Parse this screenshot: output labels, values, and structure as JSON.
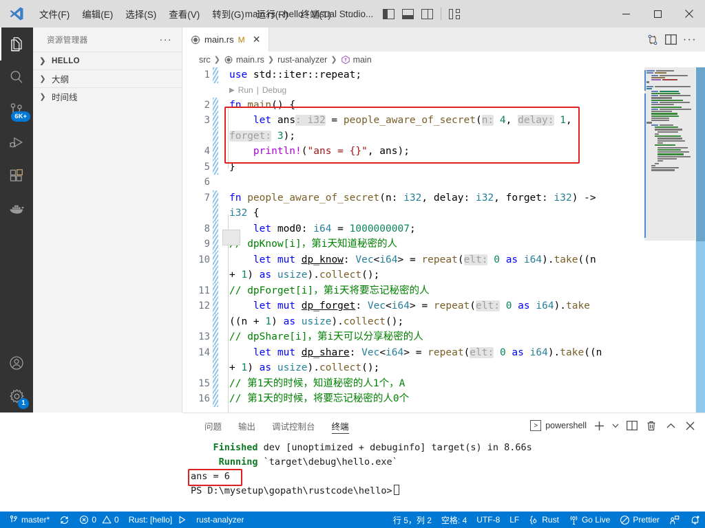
{
  "titlebar": {
    "menus": [
      "文件(F)",
      "编辑(E)",
      "选择(S)",
      "查看(V)",
      "转到(G)",
      "运行(R)",
      "终端(T)"
    ],
    "overflow": "···",
    "window_title": "main.rs - hello - Visual Studio...",
    "layout_icons": [
      "toggle-primary-sidebar-icon",
      "toggle-panel-icon",
      "toggle-secondary-sidebar-icon",
      "customize-layout-icon"
    ],
    "minimize": "─",
    "maximize": "□",
    "close": "✕"
  },
  "activitybar": {
    "items": [
      {
        "name": "explorer",
        "badge": ""
      },
      {
        "name": "search",
        "badge": ""
      },
      {
        "name": "source-control",
        "badge": "6K+"
      },
      {
        "name": "run-and-debug",
        "badge": ""
      },
      {
        "name": "extensions",
        "badge": ""
      },
      {
        "name": "docker",
        "badge": ""
      }
    ],
    "bottom": [
      {
        "name": "accounts",
        "badge": ""
      },
      {
        "name": "settings",
        "badge": "1"
      }
    ]
  },
  "sidebar": {
    "title": "资源管理器",
    "more": "···",
    "sections": [
      {
        "label": "HELLO",
        "expanded": false,
        "bold": true
      },
      {
        "label": "大纲",
        "expanded": false,
        "bold": false
      },
      {
        "label": "时间线",
        "expanded": false,
        "bold": false
      }
    ]
  },
  "editor": {
    "tab": {
      "label": "main.rs",
      "dirty": "M",
      "close": "✕",
      "icon": "rust-file-icon"
    },
    "tab_actions": [
      "split-and-compare-icon",
      "split-editor-icon",
      "more-actions-icon"
    ],
    "breadcrumb": [
      "src",
      "main.rs",
      "rust-analyzer",
      "main"
    ],
    "codelens": {
      "run": "Run",
      "sep": "|",
      "debug": "Debug"
    },
    "highlight_box": "red-selection-rectangle"
  },
  "code": {
    "lines": [
      {
        "n": "1",
        "modified": true
      },
      {
        "n": "2",
        "modified": true
      },
      {
        "n": "3",
        "modified": true
      },
      {
        "n": "4",
        "modified": true
      },
      {
        "n": "5",
        "modified": true
      },
      {
        "n": "6",
        "modified": false
      },
      {
        "n": "7",
        "modified": true
      },
      {
        "n": "8",
        "modified": true
      },
      {
        "n": "9",
        "modified": true
      },
      {
        "n": "10",
        "modified": true
      },
      {
        "n": "11",
        "modified": true
      },
      {
        "n": "12",
        "modified": true
      },
      {
        "n": "13",
        "modified": true
      },
      {
        "n": "14",
        "modified": true
      },
      {
        "n": "15",
        "modified": true
      },
      {
        "n": "16",
        "modified": true
      }
    ],
    "text": {
      "l1": "use std::iter::repeat;",
      "l2": "fn main() {",
      "l3a": "let ans: i32 = people_aware_of_secret(n: 4, delay: 1,",
      "l3b": "forget: 3);",
      "l4": "println!(\"ans = {}\", ans);",
      "l5": "}",
      "l6": "",
      "l7a": "fn people_aware_of_secret(n: i32, delay: i32, forget: i32) ->",
      "l7b": "i32 {",
      "l8": "let mod0: i64 = 1000000007;",
      "l9": "// dpKnow[i]，第i天知道秘密的人",
      "l10a": "let mut dp_know: Vec<i64> = repeat(elt: 0 as i64).take((n",
      "l10b": "+ 1) as usize).collect();",
      "l11": "// dpForget[i]，第i天将要忘记秘密的人",
      "l12a": "let mut dp_forget: Vec<i64> = repeat(elt: 0 as i64).take",
      "l12b": "((n + 1) as usize).collect();",
      "l13": "// dpShare[i]，第i天可以分享秘密的人",
      "l14a": "let mut dp_share: Vec<i64> = repeat(elt: 0 as i64).take((n",
      "l14b": "+ 1) as usize).collect();",
      "l15": "// 第1天的时候，知道秘密的人1个，A",
      "l16": "// 第1天的时候，将要忘记秘密的人0个"
    }
  },
  "panel": {
    "tabs": [
      "问题",
      "输出",
      "调试控制台",
      "终端"
    ],
    "active_tab": "终端",
    "shell": "powershell",
    "actions": [
      "new-terminal-icon",
      "terminal-dropdown-icon",
      "split-terminal-icon",
      "kill-terminal-icon",
      "collapse-panel-icon",
      "close-panel-icon"
    ],
    "terminal": {
      "line1_label": "Finished",
      "line1_rest": " dev [unoptimized + debuginfo] target(s) in 8.66s",
      "line2_label": "Running",
      "line2_rest": " `target\\debug\\hello.exe`",
      "line3": "ans = 6",
      "line4": "PS D:\\mysetup\\gopath\\rustcode\\hello>"
    }
  },
  "statusbar": {
    "left": [
      {
        "name": "remote-branch",
        "label": "master*",
        "icon": "source-control-icon"
      },
      {
        "name": "sync",
        "label": "",
        "icon": "sync-icon"
      },
      {
        "name": "problems",
        "label": "0  0",
        "errors": "0",
        "warnings": "0",
        "icon": "error-warning-icon"
      },
      {
        "name": "rust-project",
        "label": "Rust: [hello]",
        "icon": "run-icon"
      },
      {
        "name": "rust-analyzer",
        "label": "rust-analyzer",
        "icon": ""
      }
    ],
    "right": [
      {
        "name": "cursor-position",
        "label": "行 5，列 2"
      },
      {
        "name": "indentation",
        "label": "空格: 4"
      },
      {
        "name": "encoding",
        "label": "UTF-8"
      },
      {
        "name": "eol",
        "label": "LF"
      },
      {
        "name": "language-mode",
        "label": "Rust",
        "icon": "braces-icon"
      },
      {
        "name": "go-live",
        "label": "Go Live",
        "icon": "broadcast-icon"
      },
      {
        "name": "prettier",
        "label": "Prettier",
        "icon": "prettier-icon"
      },
      {
        "name": "remote-indicator",
        "label": "",
        "icon": "remote-icon"
      },
      {
        "name": "notifications",
        "label": "",
        "icon": "bell-icon"
      }
    ]
  },
  "colors": {
    "accent": "#0078d4",
    "titlebar_bg": "#dddddd",
    "activitybar_bg": "#333333",
    "sidebar_bg": "#f3f3f3",
    "highlight_red": "#e02020"
  }
}
